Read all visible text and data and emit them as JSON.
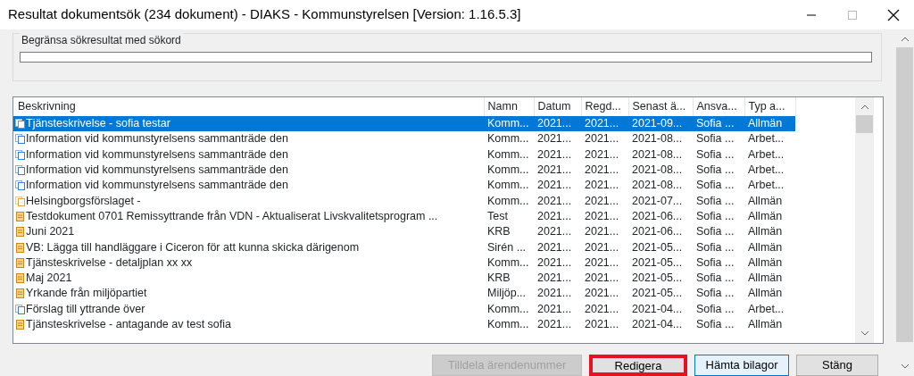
{
  "window": {
    "title": "Resultat dokumentsök (234 dokument) - DIAKS - Kommunstyrelsen [Version: 1.16.5.3]"
  },
  "filter": {
    "label": "Begränsa sökresultat med sökord"
  },
  "table": {
    "columns": [
      "Beskrivning",
      "Namn",
      "Datum",
      "Regd...",
      "Senast ä...",
      "Ansva...",
      "Typ a..."
    ],
    "rows": [
      {
        "kind": "grey-pages",
        "selected": true,
        "cells": [
          "Tjänsteskrivelse - sofia testar",
          "Komm...",
          "2021...",
          "2021...",
          "2021-09...",
          "Sofia ...",
          "Allmän"
        ]
      },
      {
        "kind": "blue-pages",
        "selected": false,
        "cells": [
          "Information vid kommunstyrelsens sammanträde den",
          "Komm...",
          "2021...",
          "2021...",
          "2021-08...",
          "Sofia ...",
          "Arbet..."
        ]
      },
      {
        "kind": "blue-pages",
        "selected": false,
        "cells": [
          "Information vid kommunstyrelsens sammanträde den",
          "Komm...",
          "2021...",
          "2021...",
          "2021-08...",
          "Sofia ...",
          "Arbet..."
        ]
      },
      {
        "kind": "blue-pages",
        "selected": false,
        "cells": [
          "Information vid kommunstyrelsens sammanträde den",
          "Komm...",
          "2021...",
          "2021...",
          "2021-08...",
          "Sofia ...",
          "Arbet..."
        ]
      },
      {
        "kind": "blue-pages",
        "selected": false,
        "cells": [
          "Information vid kommunstyrelsens sammanträde den",
          "Komm...",
          "2021...",
          "2021...",
          "2021-08...",
          "Sofia ...",
          "Arbet..."
        ]
      },
      {
        "kind": "orange-pages",
        "selected": false,
        "cells": [
          "Helsingborgsförslaget -",
          "Komm...",
          "2021...",
          "2021...",
          "2021-07...",
          "Sofia ...",
          "Allmän"
        ]
      },
      {
        "kind": "doc",
        "selected": false,
        "cells": [
          "Testdokument 0701 Remissyttrande från  VDN - Aktualiserat Livskvalitetsprogram ...",
          "Test",
          "2021...",
          "2021...",
          "2021-06...",
          "Sofia ...",
          "Allmän"
        ]
      },
      {
        "kind": "doc",
        "selected": false,
        "cells": [
          "Juni 2021",
          "KRB",
          "2021...",
          "2021...",
          "2021-06...",
          "Sofia ...",
          "Allmän"
        ]
      },
      {
        "kind": "doc",
        "selected": false,
        "cells": [
          "VB: Lägga till handläggare i Ciceron för att kunna skicka därigenom",
          "Sirén ...",
          "2021...",
          "2021...",
          "2021-05...",
          "Sofia ...",
          "Allmän"
        ]
      },
      {
        "kind": "doc",
        "selected": false,
        "cells": [
          "Tjänsteskrivelse - detaljplan xx xx",
          "Komm...",
          "2021...",
          "2021...",
          "2021-05...",
          "Sofia ...",
          "Allmän"
        ]
      },
      {
        "kind": "doc",
        "selected": false,
        "cells": [
          "Maj 2021",
          "KRB",
          "2021...",
          "2021...",
          "2021-05...",
          "Sofia ...",
          "Allmän"
        ]
      },
      {
        "kind": "doc",
        "selected": false,
        "cells": [
          "Yrkande från miljöpartiet",
          "Miljöp...",
          "2021...",
          "2021...",
          "2021-05...",
          "Sofia ...",
          "Allmän"
        ]
      },
      {
        "kind": "blue-pages",
        "selected": false,
        "cells": [
          "Förslag till yttrande över",
          "Komm...",
          "2021...",
          "2021...",
          "2021-04...",
          "Sofia ...",
          "Arbet..."
        ]
      },
      {
        "kind": "doc",
        "selected": false,
        "cells": [
          "Tjänsteskrivelse - antagande av test sofia",
          "Komm...",
          "2021...",
          "2021...",
          "2021-04...",
          "Sofia ...",
          "Allmän"
        ]
      }
    ]
  },
  "buttons": [
    {
      "label": "Tilldela ärendenummer",
      "disabled": true,
      "default": false,
      "highlighted": false
    },
    {
      "label": "Redigera",
      "disabled": false,
      "default": false,
      "highlighted": true
    },
    {
      "label": "Hämta bilagor",
      "disabled": false,
      "default": true,
      "highlighted": false
    },
    {
      "label": "Stäng",
      "disabled": false,
      "default": false,
      "highlighted": false
    }
  ]
}
